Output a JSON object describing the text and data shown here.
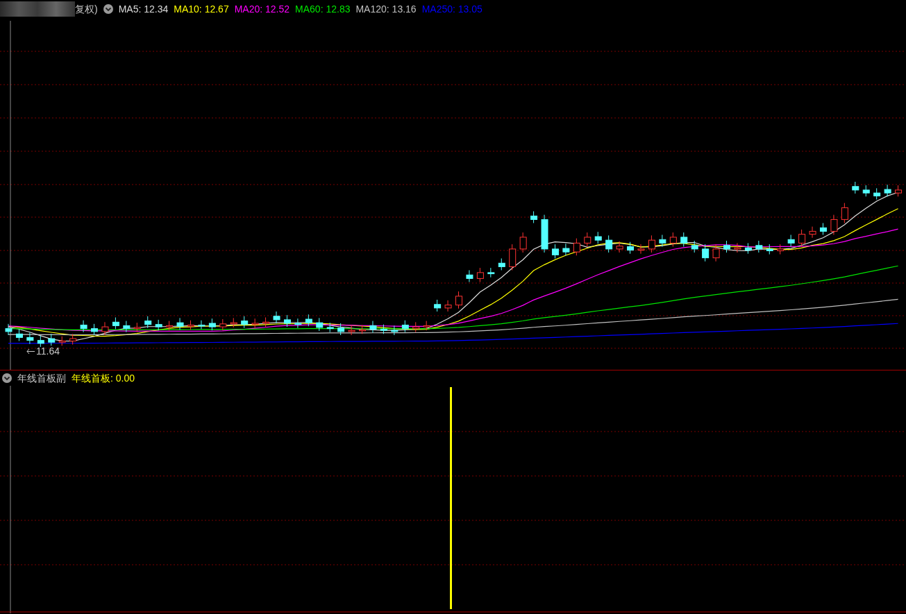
{
  "main_panel": {
    "title_suffix": "复权)",
    "moving_averages": [
      {
        "label": "MA5: 12.34",
        "color": "#dcdcdc"
      },
      {
        "label": "MA10: 12.67",
        "color": "#ffff00"
      },
      {
        "label": "MA20: 12.52",
        "color": "#ff00ff"
      },
      {
        "label": "MA60: 12.83",
        "color": "#00e600"
      },
      {
        "label": "MA120: 13.16",
        "color": "#c0c0c0"
      },
      {
        "label": "MA250: 13.05",
        "color": "#0000ff"
      }
    ],
    "low_marker": "11.64"
  },
  "indicator_panel": {
    "name": "年线首板副",
    "value_label": "年线首板: 0.00"
  }
}
